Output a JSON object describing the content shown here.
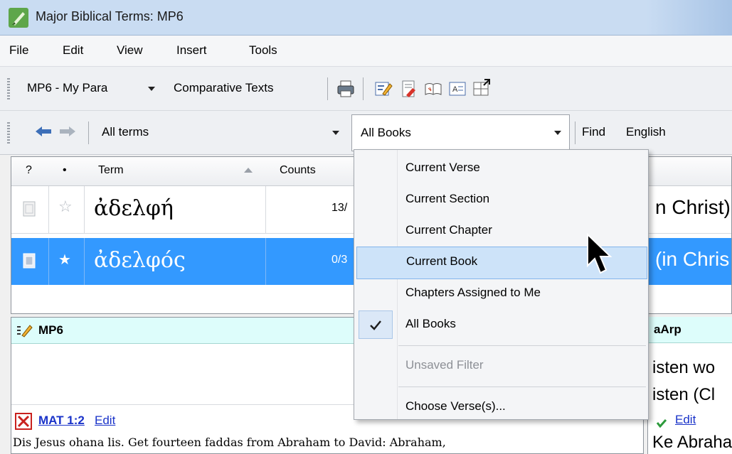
{
  "window": {
    "title": "Major Biblical Terms: MP6"
  },
  "menu": [
    "File",
    "Edit",
    "View",
    "Insert",
    "Tools"
  ],
  "toolbar1": {
    "project": "MP6 - My Para",
    "comparative": "Comparative Texts"
  },
  "toolbar2": {
    "terms_filter": "All terms",
    "books_filter": "All Books",
    "find_label": "Find",
    "find_value": "English"
  },
  "grid": {
    "headers": {
      "q": "?",
      "star": "•",
      "term": "Term",
      "counts": "Counts"
    },
    "rows": [
      {
        "term": "ἀδελφή",
        "count": "13/",
        "gloss": "n Christ)",
        "starred": "☆"
      },
      {
        "term": "ἀδελφός",
        "count": "0/3",
        "gloss": "(in Chris",
        "starred": "★"
      }
    ]
  },
  "dropdown": {
    "items": [
      "Current Verse",
      "Current Section",
      "Current Chapter",
      "Current Book",
      "Chapters Assigned to Me",
      "All Books",
      "Unsaved Filter",
      "Choose Verse(s)..."
    ],
    "checked": "All Books",
    "hovered": "Current Book",
    "disabled": "Unsaved Filter"
  },
  "leftpane": {
    "title": "MP6",
    "reference": "MAT 1:2",
    "edit": "Edit",
    "text": "Dis Jesus ohana lis. Get fourteen faddas from Abraham to David: Abraham,"
  },
  "rightpane": {
    "title": "aArp",
    "line1": "isten wo",
    "line2": "isten (Cl",
    "edit": "Edit",
    "text": "Ke Abraha"
  },
  "colors": {
    "selection": "#3399ff",
    "hover": "#cde3f9",
    "link": "#1a33c9",
    "pane_header": "#ddfdfb"
  }
}
